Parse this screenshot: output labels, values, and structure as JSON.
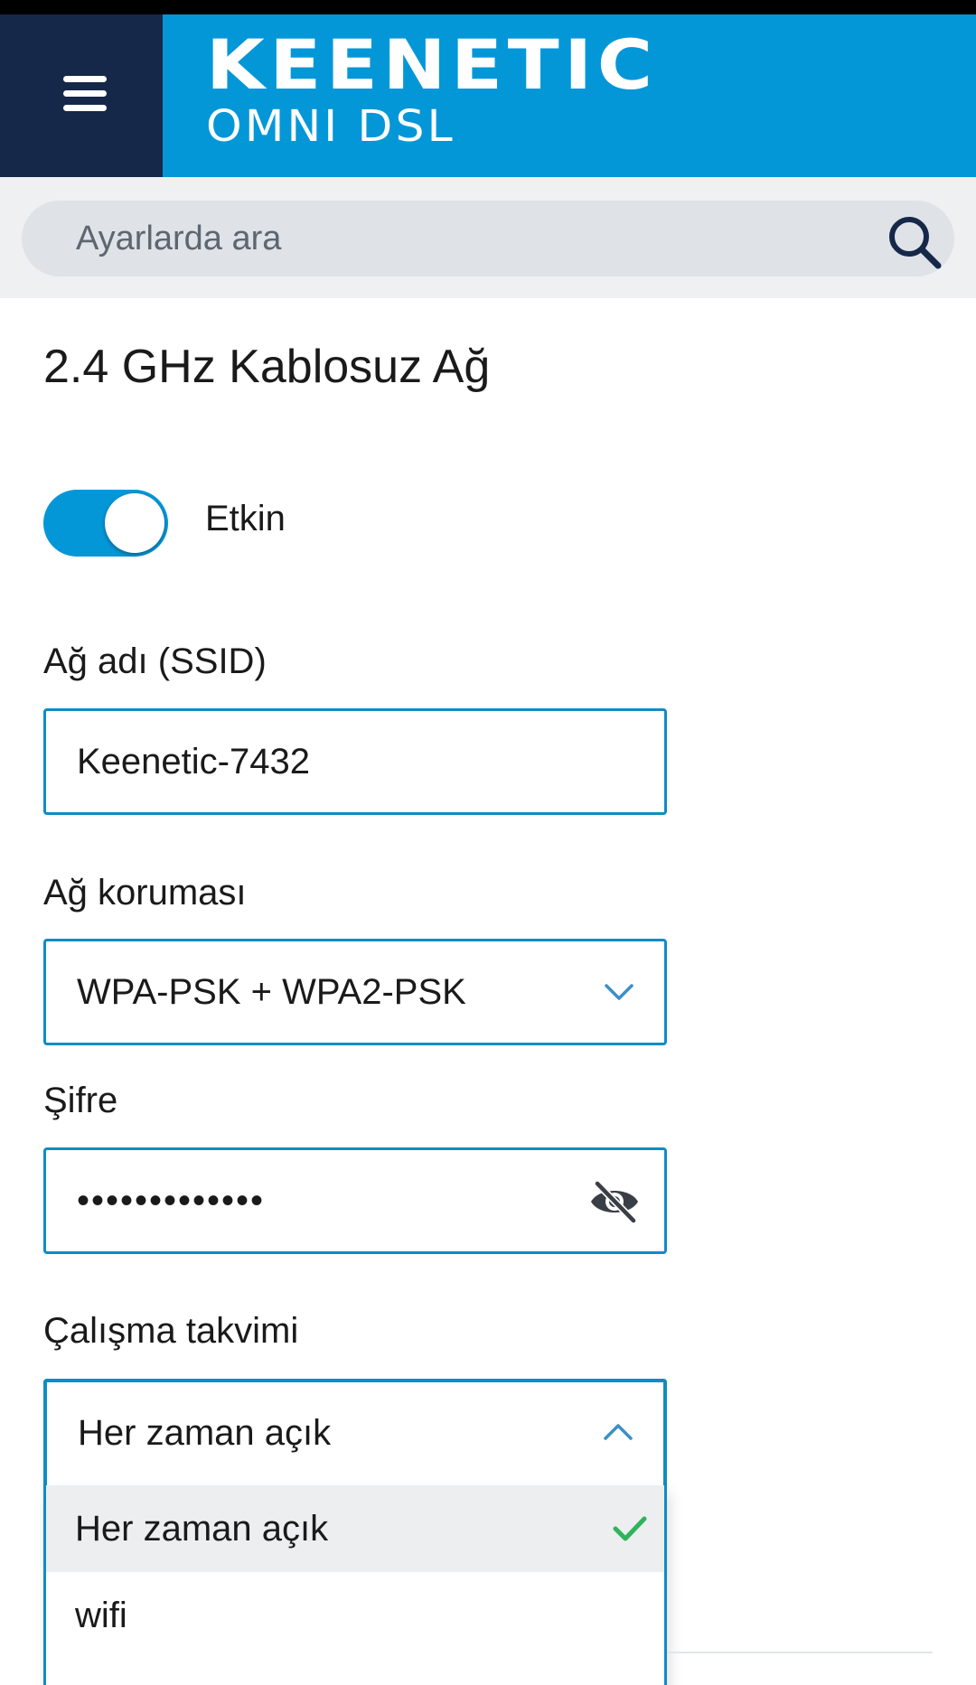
{
  "header": {
    "brand": "KEENETIC",
    "model": "OMNI DSL"
  },
  "search": {
    "placeholder": "Ayarlarda ara"
  },
  "page": {
    "title": "2.4 GHz Kablosuz Ağ"
  },
  "toggle": {
    "label": "Etkin",
    "state": "on"
  },
  "fields": {
    "ssid": {
      "label": "Ağ adı (SSID)",
      "value": "Keenetic-7432"
    },
    "security": {
      "label": "Ağ koruması",
      "value": "WPA-PSK + WPA2-PSK"
    },
    "password": {
      "label": "Şifre",
      "value": "•••••••••••••"
    },
    "schedule": {
      "label": "Çalışma takvimi",
      "value": "Her zaman açık",
      "options": [
        "Her zaman açık",
        "wifi"
      ]
    }
  },
  "icons": {
    "menu": "hamburger-icon",
    "search": "search-icon",
    "security_dropdown": "chevron-down-icon",
    "password_visibility": "eye-off-icon",
    "schedule_dropdown": "chevron-up-icon",
    "selected": "check-icon"
  },
  "colors": {
    "brand_blue": "#0497d8",
    "nav_dark": "#162849",
    "field_border": "#0f8cc6",
    "check_green": "#2fb35c"
  }
}
